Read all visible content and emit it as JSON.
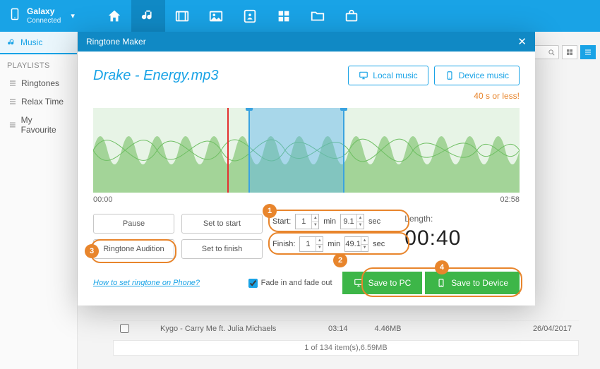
{
  "device": {
    "name": "Galaxy",
    "status": "Connected"
  },
  "sidebar": {
    "music_tab": "Music",
    "playlists_head": "PLAYLISTS",
    "items": [
      "Ringtones",
      "Relax Time",
      "My Favourite"
    ]
  },
  "modal": {
    "title": "Ringtone Maker",
    "filename": "Drake - Energy.mp3",
    "local_btn": "Local music",
    "device_btn": "Device music",
    "warn": "40 s or less!",
    "time_start": "00:00",
    "time_end": "02:58",
    "pause": "Pause",
    "set_start": "Set to start",
    "ringtone_audition": "Ringtone Audition",
    "set_finish": "Set to finish",
    "start_label": "Start:",
    "finish_label": "Finish:",
    "min": "min",
    "sec": "sec",
    "start_min": "1",
    "start_sec": "9.1",
    "finish_min": "1",
    "finish_sec": "49.1",
    "length_label": "Length:",
    "length_val": "00:40",
    "help": "How to set ringtone on Phone?",
    "fade": "Fade in and fade out",
    "save_pc": "Save to PC",
    "save_device": "Save to Device"
  },
  "callouts": {
    "c1": "1",
    "c2": "2",
    "c3": "3",
    "c4": "4"
  },
  "bg": {
    "row_title": "Kygo - Carry Me ft. Julia Michaels",
    "row_dur": "03:14",
    "row_size": "4.46MB",
    "row_date": "26/04/2017",
    "footer": "1 of 134 item(s),6.59MB"
  }
}
